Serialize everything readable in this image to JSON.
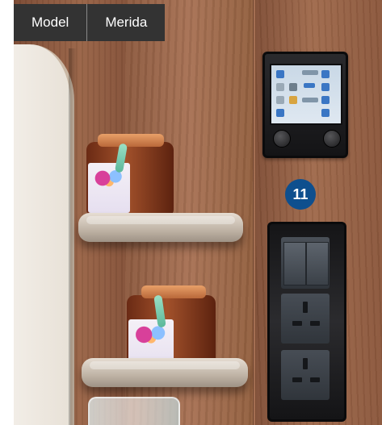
{
  "caption": {
    "model_label": "Model",
    "model_value": "Merida"
  },
  "callout": {
    "number": "11",
    "color": "#0e4f8e"
  },
  "colors": {
    "caption_bg": "#333333",
    "caption_text": "#ffffff"
  }
}
